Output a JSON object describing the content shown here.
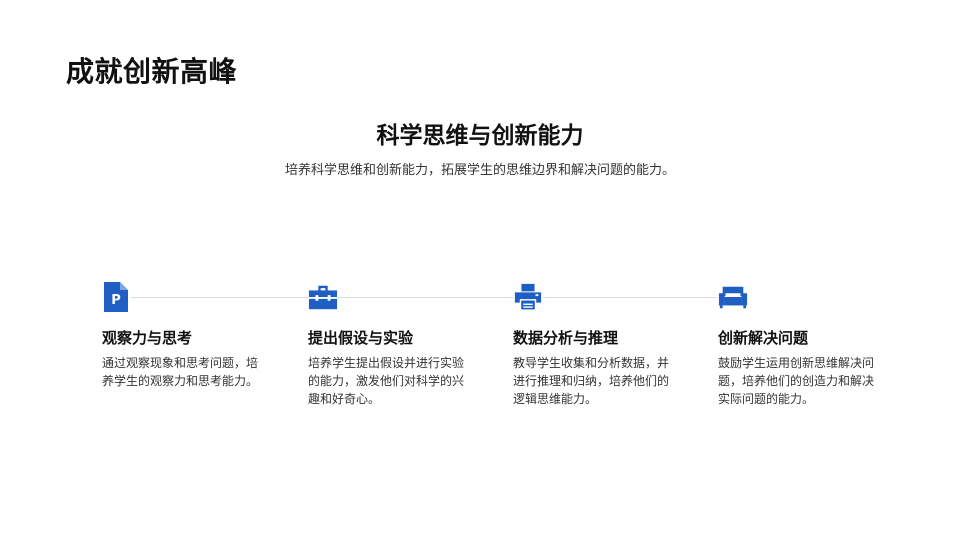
{
  "slide": {
    "title": "成就创新高峰"
  },
  "header": {
    "heading": "科学思维与创新能力",
    "subheading": "培养科学思维和创新能力，拓展学生的思维边界和解决问题的能力。"
  },
  "colors": {
    "accent": "#1f5fc4",
    "line": "#d9dde5"
  },
  "steps": [
    {
      "icon": "document-p-icon",
      "title": "观察力与思考",
      "desc": "通过观察现象和思考问题，培养学生的观察力和思考能力。"
    },
    {
      "icon": "toolbox-icon",
      "title": "提出假设与实验",
      "desc": "培养学生提出假设并进行实验的能力，激发他们对科学的兴趣和好奇心。"
    },
    {
      "icon": "printer-icon",
      "title": "数据分析与推理",
      "desc": "教导学生收集和分析数据，并进行推理和归纳，培养他们的逻辑思维能力。"
    },
    {
      "icon": "sofa-icon",
      "title": "创新解决问题",
      "desc": "鼓励学生运用创新思维解决问题，培养他们的创造力和解决实际问题的能力。"
    }
  ]
}
